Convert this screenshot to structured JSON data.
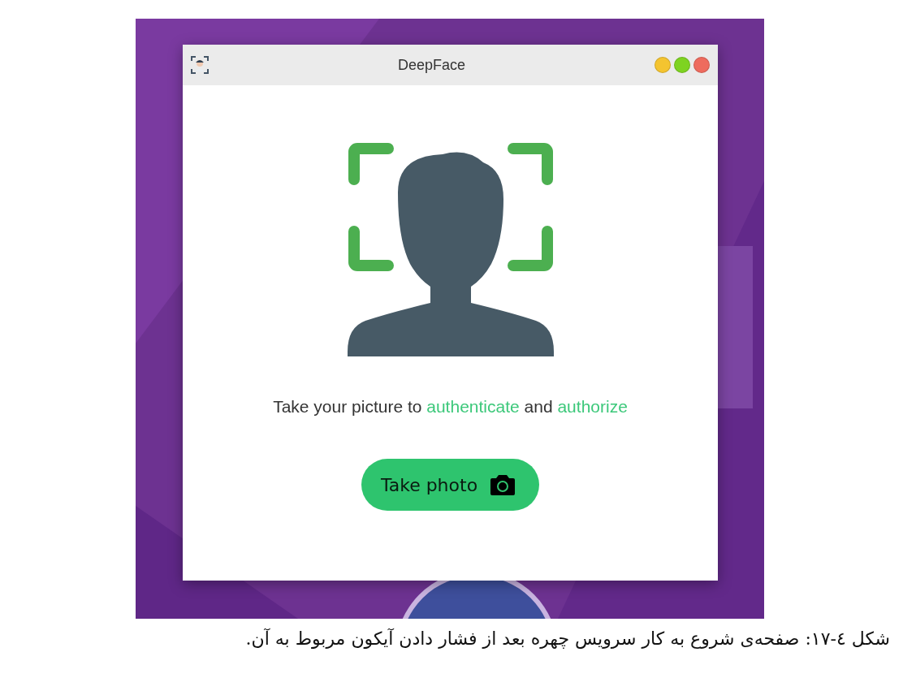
{
  "window": {
    "title": "DeepFace",
    "controls": [
      {
        "color": "#f4c430"
      },
      {
        "color": "#7ed321"
      },
      {
        "color": "#ee6b5e"
      }
    ]
  },
  "prompt": [
    {
      "text": "Take your picture to",
      "highlight": false
    },
    {
      "text": "authenticate",
      "highlight": true
    },
    {
      "text": "and",
      "highlight": false
    },
    {
      "text": "authorize",
      "highlight": true
    }
  ],
  "button": {
    "label": "Take photo"
  },
  "caption": "شکل ٤-١٧: صفحه‌ی شروع به کار سرویس چهره بعد از فشار دادن آیکون مربوط به آن."
}
